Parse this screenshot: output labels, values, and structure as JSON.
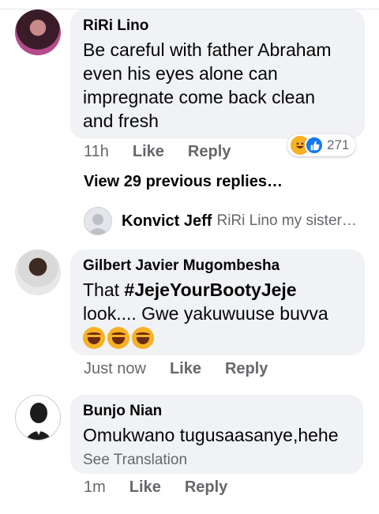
{
  "comments": [
    {
      "author": "RiRi Lino",
      "text": "Be careful with father Abraham even his eyes alone can impregnate come back clean and fresh",
      "time": "11h",
      "like_label": "Like",
      "reply_label": "Reply",
      "reaction_count": "271",
      "reaction_icons": [
        "haha-icon",
        "like-icon"
      ]
    },
    {
      "author": "Gilbert Javier Mugombesha",
      "text_prefix": "That ",
      "hashtag": "#JejeYourBootyJeje",
      "text_line2": "look.... Gwe yakuwuuse buvva",
      "emojis": [
        "laughing-emoji",
        "laughing-emoji",
        "laughing-emoji"
      ],
      "time": "Just now",
      "like_label": "Like",
      "reply_label": "Reply"
    },
    {
      "author": "Bunjo Nian",
      "text": "Omukwano tugusaasanye,hehe",
      "see_translation": "See Translation",
      "time": "1m",
      "like_label": "Like",
      "reply_label": "Reply"
    }
  ],
  "thread": {
    "view_previous": "View 29 previous replies…",
    "reply_author": "Konvict Jeff",
    "reply_snippet": "RiRi Lino my sister…"
  },
  "colors": {
    "bubble": "#f0f2f5",
    "secondary_text": "#65676b",
    "like_blue": "#1877f2",
    "haha_yellow": "#f7b125"
  }
}
